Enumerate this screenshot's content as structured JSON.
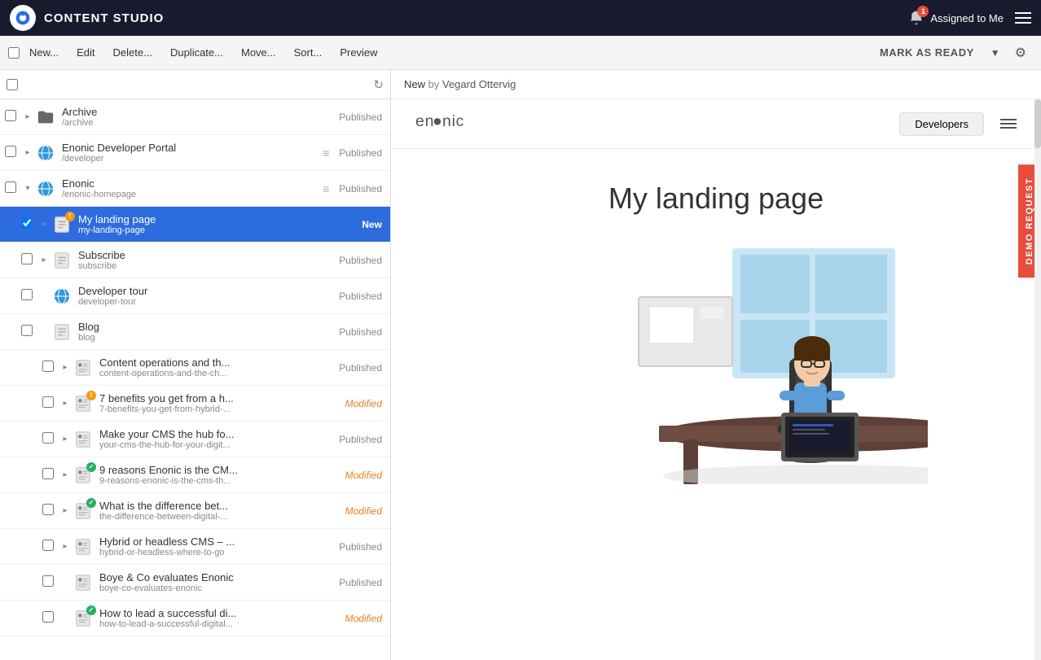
{
  "app": {
    "title": "CONTENT STUDIO"
  },
  "topbar": {
    "assigned_label": "Assigned to Me",
    "notification_count": "1",
    "mark_ready_label": "MARK AS READY"
  },
  "toolbar": {
    "buttons": [
      "New...",
      "Edit",
      "Delete...",
      "Duplicate...",
      "Move...",
      "Sort...",
      "Preview"
    ]
  },
  "preview_header": {
    "title": "New",
    "by": "by",
    "author": "Vegard Ottervig"
  },
  "site_preview": {
    "logo": "enonic",
    "nav_btn": "Developers",
    "hero_title": "My landing page",
    "demo_btn": "DEMO REQUEST"
  },
  "tree_items": [
    {
      "id": 1,
      "indent": 0,
      "name": "Archive",
      "path": "/archive",
      "status": "Published",
      "status_type": "published",
      "has_expand": true,
      "expand_open": false,
      "icon_type": "folder",
      "badge": null
    },
    {
      "id": 2,
      "indent": 0,
      "name": "Enonic Developer Portal",
      "path": "/developer",
      "status": "Published",
      "status_type": "published",
      "has_expand": true,
      "expand_open": false,
      "icon_type": "globe",
      "badge": null,
      "has_drag": true
    },
    {
      "id": 3,
      "indent": 0,
      "name": "Enonic",
      "path": "/enonic-homepage",
      "status": "Published",
      "status_type": "published",
      "has_expand": true,
      "expand_open": true,
      "icon_type": "globe",
      "badge": null,
      "has_drag": true
    },
    {
      "id": 4,
      "indent": 1,
      "name": "My landing page",
      "path": "my-landing-page",
      "status": "New",
      "status_type": "new",
      "has_expand": true,
      "expand_open": false,
      "icon_type": "page",
      "badge": "warning",
      "selected": true
    },
    {
      "id": 5,
      "indent": 1,
      "name": "Subscribe",
      "path": "subscribe",
      "status": "Published",
      "status_type": "published",
      "has_expand": true,
      "expand_open": false,
      "icon_type": "page",
      "badge": null
    },
    {
      "id": 6,
      "indent": 1,
      "name": "Developer tour",
      "path": "developer-tour",
      "status": "Published",
      "status_type": "published",
      "has_expand": false,
      "icon_type": "globe2",
      "badge": null
    },
    {
      "id": 7,
      "indent": 1,
      "name": "Blog",
      "path": "blog",
      "status": "Published",
      "status_type": "published",
      "has_expand": false,
      "expand_open": true,
      "icon_type": "page",
      "badge": null
    },
    {
      "id": 8,
      "indent": 2,
      "name": "Content operations and th...",
      "path": "content-operations-and-the-ch...",
      "status": "Published",
      "status_type": "published",
      "has_expand": true,
      "icon_type": "blog",
      "badge": null
    },
    {
      "id": 9,
      "indent": 2,
      "name": "7 benefits you get from a h...",
      "path": "7-benefits-you-get-from-hybrid-...",
      "status": "Modified",
      "status_type": "modified",
      "has_expand": true,
      "icon_type": "blog",
      "badge": "warning"
    },
    {
      "id": 10,
      "indent": 2,
      "name": "Make your CMS the hub fo...",
      "path": "your-cms-the-hub-for-your-digit...",
      "status": "Published",
      "status_type": "published",
      "has_expand": true,
      "icon_type": "blog",
      "badge": null
    },
    {
      "id": 11,
      "indent": 2,
      "name": "9 reasons Enonic is the CM...",
      "path": "9-reasons-enonic-is-the-cms-th...",
      "status": "Modified",
      "status_type": "modified",
      "has_expand": true,
      "icon_type": "blog",
      "badge": "success"
    },
    {
      "id": 12,
      "indent": 2,
      "name": "What is the difference bet...",
      "path": "the-difference-between-digital-...",
      "status": "Modified",
      "status_type": "modified",
      "has_expand": true,
      "icon_type": "blog",
      "badge": "success"
    },
    {
      "id": 13,
      "indent": 2,
      "name": "Hybrid or headless CMS – ...",
      "path": "hybrid-or-headless-where-to-go",
      "status": "Published",
      "status_type": "published",
      "has_expand": true,
      "icon_type": "blog",
      "badge": null
    },
    {
      "id": 14,
      "indent": 2,
      "name": "Boye & Co evaluates Enonic",
      "path": "boye-co-evaluates-enonic",
      "status": "Published",
      "status_type": "published",
      "has_expand": false,
      "icon_type": "blog",
      "badge": null
    },
    {
      "id": 15,
      "indent": 2,
      "name": "How to lead a successful di...",
      "path": "how-to-lead-a-successful-digital...",
      "status": "Modified",
      "status_type": "modified",
      "has_expand": false,
      "icon_type": "blog",
      "badge": "success"
    }
  ]
}
